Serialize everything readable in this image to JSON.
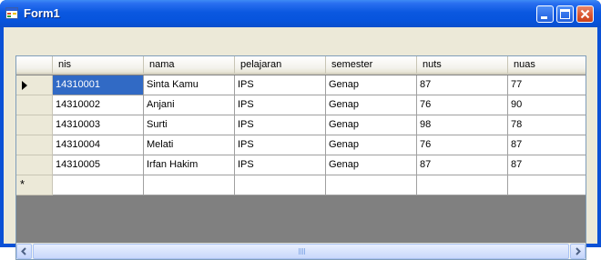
{
  "window": {
    "title": "Form1",
    "icon": "form-app-icon",
    "buttons": [
      {
        "name": "minimize",
        "icon": "minimize-icon"
      },
      {
        "name": "maximize",
        "icon": "maximize-icon"
      },
      {
        "name": "close",
        "icon": "close-icon"
      }
    ]
  },
  "grid": {
    "columns": [
      "nis",
      "nama",
      "pelajaran",
      "semester",
      "nuts",
      "nuas"
    ],
    "rows": [
      [
        "14310001",
        "Sinta Kamu",
        "IPS",
        "Genap",
        "87",
        "77"
      ],
      [
        "14310002",
        "Anjani",
        "IPS",
        "Genap",
        "76",
        "90"
      ],
      [
        "14310003",
        "Surti",
        "IPS",
        "Genap",
        "98",
        "78"
      ],
      [
        "14310004",
        "Melati",
        "IPS",
        "Genap",
        "76",
        "87"
      ],
      [
        "14310005",
        "Irfan Hakim",
        "IPS",
        "Genap",
        "87",
        "87"
      ]
    ],
    "current_row_indicator": "current-row-arrow-icon",
    "new_row_indicator": "*",
    "selected_cell": {
      "row": 0,
      "column": 0
    }
  },
  "colors": {
    "titlebar": "#0754dd",
    "client_bg": "#ece9d8",
    "selection": "#316ac5",
    "grid_background": "#808080"
  }
}
